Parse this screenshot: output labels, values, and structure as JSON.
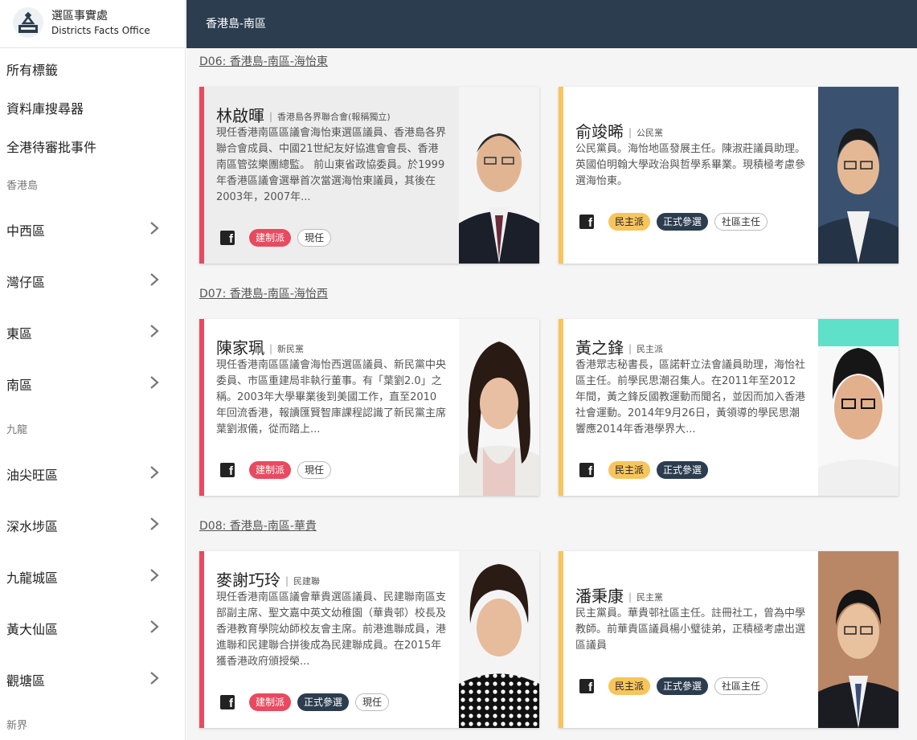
{
  "logo": {
    "zh": "選區事實處",
    "en": "Districts Facts Office"
  },
  "sidebar": {
    "top_links": [
      "所有標籤",
      "資料庫搜尋器",
      "全港待審批事件"
    ],
    "regions": {
      "hk_island": "香港島",
      "kowloon": "九龍",
      "nt": "新界"
    },
    "hk_districts": [
      "中西區",
      "灣仔區",
      "東區",
      "南區"
    ],
    "kln_districts": [
      "油尖旺區",
      "深水埗區",
      "九龍城區",
      "黃大仙區",
      "觀塘區"
    ]
  },
  "header": {
    "title": "香港島-南區"
  },
  "sections": [
    {
      "title": "D06: 香港島-南區-海怡東",
      "candidates": [
        {
          "name": "林啟暉",
          "party": "香港島各界聯合會(報稱獨立)",
          "desc": "現任香港南區區議會海怡東選區議員、香港島各界聯合會成員、中國21世紀友好協進會會長、香港南區管弦樂團總監。 前山東省政協委員。於1999年香港區議會選舉首次當選海怡東議員，其後在2003年，2007年...",
          "tags": [
            "建制派",
            "現任"
          ]
        },
        {
          "name": "俞竣晞",
          "party": "公民黨",
          "desc": "公民黨員。海怡地區發展主任。陳淑莊議員助理。英國伯明翰大學政治與哲學系畢業。現積極考慮參選海怡東。",
          "tags": [
            "民主派",
            "正式參選",
            "社區主任"
          ]
        }
      ]
    },
    {
      "title": "D07: 香港島-南區-海怡西",
      "candidates": [
        {
          "name": "陳家珮",
          "party": "新民黨",
          "desc": "現任香港南區區議會海怡西選區議員、新民黨中央委員、市區重建局非執行董事。有「葉劉2.0」之稱。2003年大學畢業後到美國工作，直至2010年回流香港，報讀匯賢智庫課程認識了新民黨主席葉劉淑儀，從而踏上...",
          "tags": [
            "建制派",
            "現任"
          ]
        },
        {
          "name": "黃之鋒",
          "party": "民主派",
          "desc": "香港眾志秘書長，區諾軒立法會議員助理，海怡社區主任。前學民思潮召集人。在2011年至2012年間，黃之鋒反國教運動而聞名，並因而加入香港社會運動。2014年9月26日，黃領導的學民思潮響應2014年香港學界大...",
          "tags": [
            "民主派",
            "正式參選"
          ]
        }
      ]
    },
    {
      "title": "D08: 香港島-南區-華貴",
      "candidates": [
        {
          "name": "麥謝巧玲",
          "party": "民建聯",
          "desc": "現任香港南區區議會華貴選區議員、民建聯南區支部副主席、聖文嘉中英文幼稚園（華貴邨）校長及香港教育學院幼師校友會主席。前港進聯成員，港進聯和民建聯合拼後成為民建聯成員。在2015年獲香港政府頒授榮...",
          "tags": [
            "建制派",
            "正式參選",
            "現任"
          ]
        },
        {
          "name": "潘秉康",
          "party": "民主黨",
          "desc": "民主黨員。華貴邨社區主任。註冊社工，曾為中學教師。前華貴區議員楊小璧徒弟，正積極考慮出選區議員",
          "tags": [
            "民主派",
            "正式參選",
            "社區主任"
          ]
        }
      ]
    }
  ]
}
